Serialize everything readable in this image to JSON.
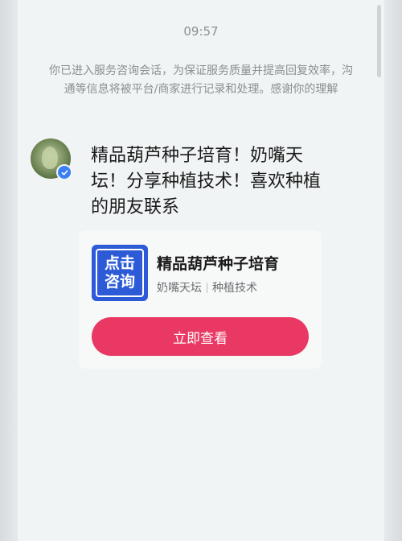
{
  "chat": {
    "timestamp": "09:57",
    "notice": "你已进入服务咨询会话，为保证服务质量并提高回复效率，沟通等信息将被平台/商家进行记录和处理。感谢你的理解",
    "message": {
      "text": "精品葫芦种子培育！奶嘴天坛！分享种植技术！喜欢种植的朋友联系",
      "sender_verified": true
    }
  },
  "card": {
    "logo_line1": "点击",
    "logo_line2": "咨询",
    "title": "精品葫芦种子培育",
    "tags": [
      "奶嘴天坛",
      "种植技术"
    ],
    "button_label": "立即查看"
  },
  "colors": {
    "accent": "#e83863",
    "logo_blue": "#2d5bd8",
    "verified_blue": "#3b7ff5"
  }
}
